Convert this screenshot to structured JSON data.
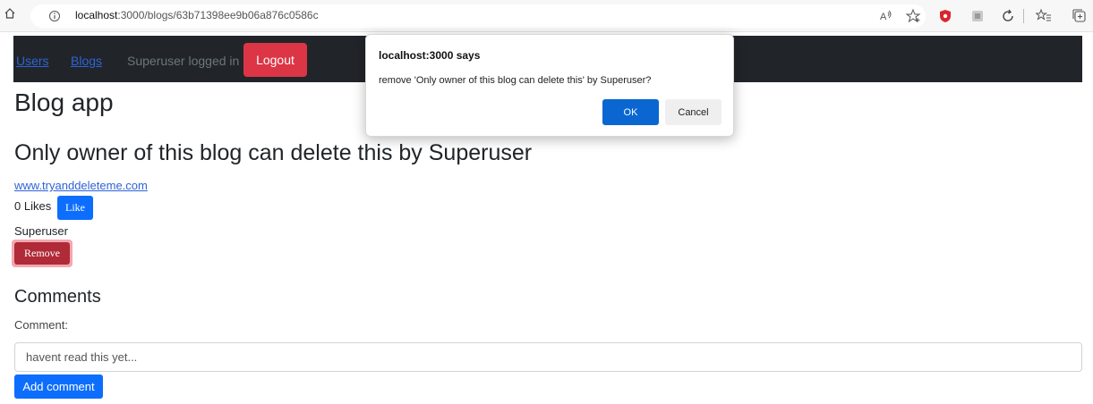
{
  "browser": {
    "url_host": "localhost",
    "url_path": ":3000/blogs/63b71398ee9b06a876c0586c",
    "icons": [
      "home-icon",
      "info-icon",
      "read-aloud-icon",
      "favorite-add-icon",
      "shield-icon",
      "extension-icon",
      "refresh-icon",
      "favorites-icon",
      "collections-icon"
    ]
  },
  "navbar": {
    "users_label": "Users",
    "blogs_label": "Blogs",
    "logged_in_text": "Superuser logged in",
    "logout_label": "Logout"
  },
  "app": {
    "title": "Blog app"
  },
  "blog": {
    "title": "Only owner of this blog can delete this by Superuser",
    "url": "www.tryanddeleteme.com",
    "likes_text": "0 Likes",
    "like_label": "Like",
    "author": "Superuser",
    "remove_label": "Remove"
  },
  "comments": {
    "title": "Comments",
    "label": "Comment:",
    "input_placeholder": "havent read this yet...",
    "add_label": "Add comment"
  },
  "dialog": {
    "title": "localhost:3000 says",
    "message": "remove 'Only owner of this blog can delete this' by Superuser?",
    "ok_label": "OK",
    "cancel_label": "Cancel"
  },
  "colors": {
    "navbar_bg": "#212529",
    "danger": "#dc3545",
    "primary": "#0d6efd",
    "link": "#2e63d6"
  }
}
